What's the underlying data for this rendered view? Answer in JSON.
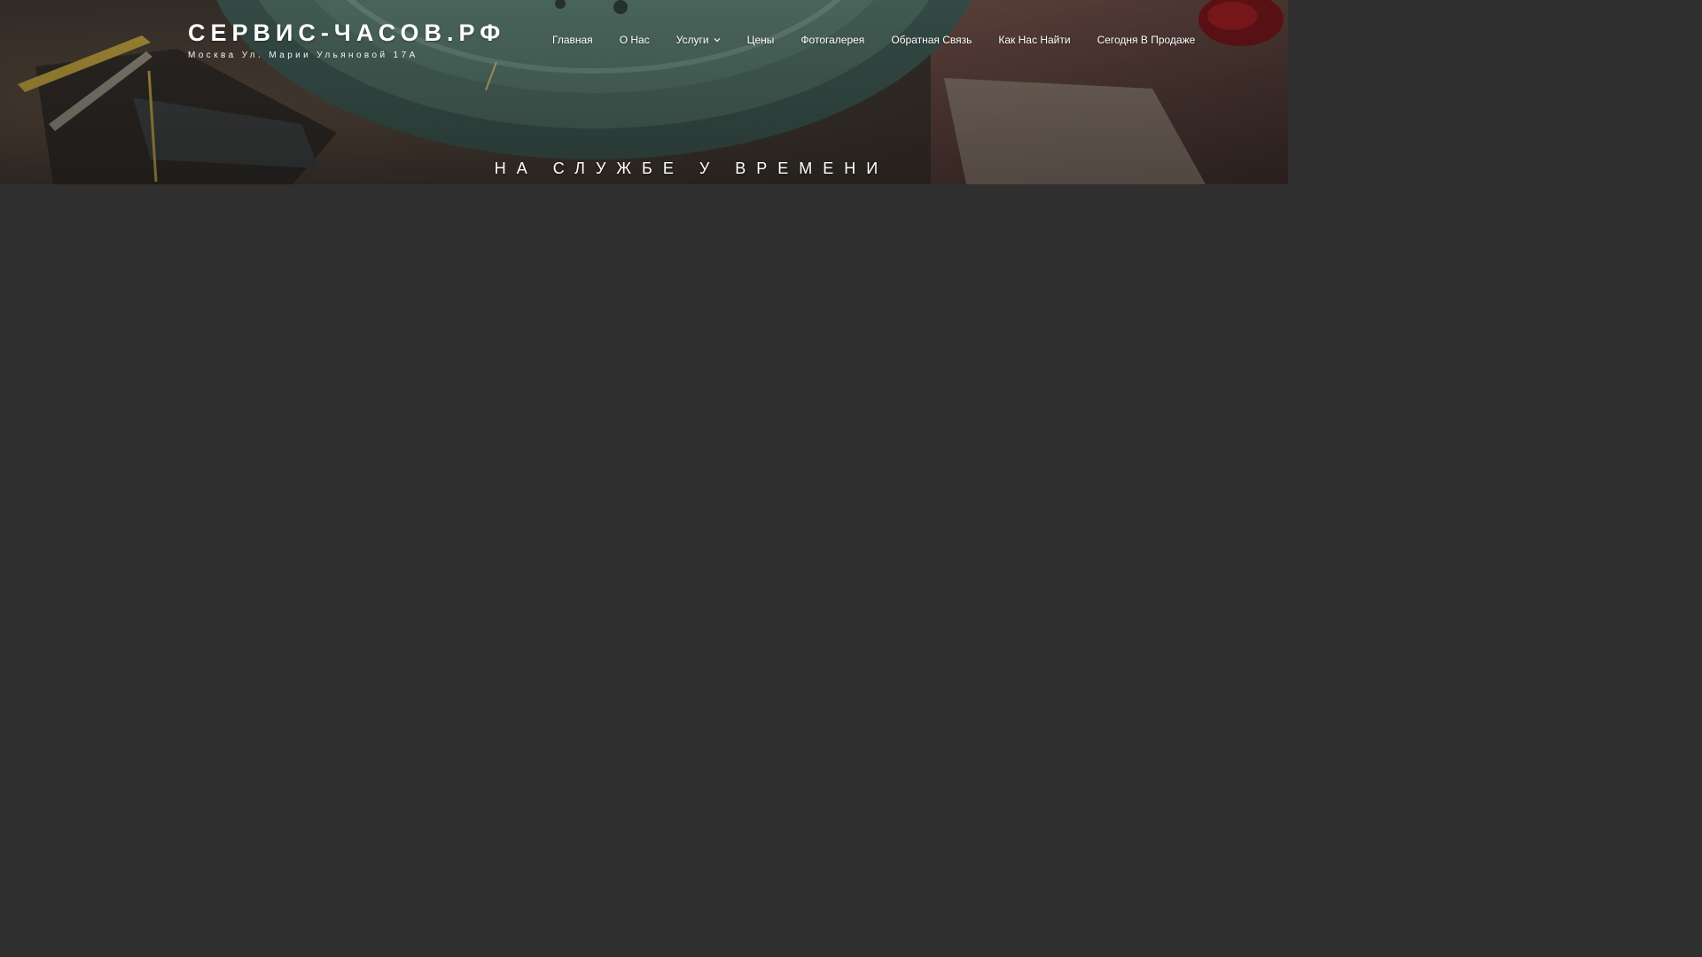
{
  "site": {
    "title": "СЕРВИС-ЧАСОВ.РФ",
    "description": "Москва Ул. Марии Ульяновой 17А"
  },
  "nav": {
    "items": [
      {
        "label": "Главная"
      },
      {
        "label": "О Нас"
      },
      {
        "label": "Услуги",
        "has_submenu": true,
        "icon": "chevron-down-icon"
      },
      {
        "label": "Цены"
      },
      {
        "label": "Фотогалерея"
      },
      {
        "label": "Обратная Связь"
      },
      {
        "label": "Как Нас Найти"
      },
      {
        "label": "Сегодня В Продаже"
      }
    ]
  },
  "hero": {
    "tagline": "НА СЛУЖБЕ У ВРЕМЕНИ"
  },
  "colors": {
    "page_background": "#2f2f2f",
    "text": "#ffffff",
    "clock_green": "#4c6a5f"
  }
}
